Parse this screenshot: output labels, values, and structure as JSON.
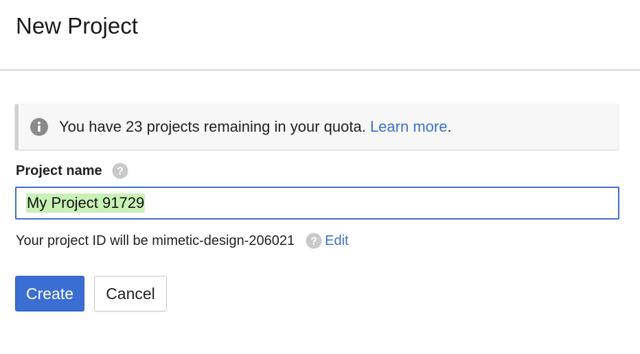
{
  "header": {
    "title": "New Project"
  },
  "quota": {
    "message": "You have 23 projects remaining in your quota.",
    "link_label": "Learn more",
    "trailing": ".",
    "icon": "info-icon"
  },
  "form": {
    "project_name_label": "Project name",
    "project_name_value": "My Project 91729",
    "help_icon": "help-icon",
    "project_id_prefix": "Your project ID will be mimetic-design-206021",
    "edit_label": "Edit"
  },
  "actions": {
    "create_label": "Create",
    "cancel_label": "Cancel"
  },
  "colors": {
    "accent": "#3b6ed3",
    "link": "#3b6fd1",
    "selection_highlight": "#c8f1b6",
    "input_border": "#3f6fc8"
  }
}
